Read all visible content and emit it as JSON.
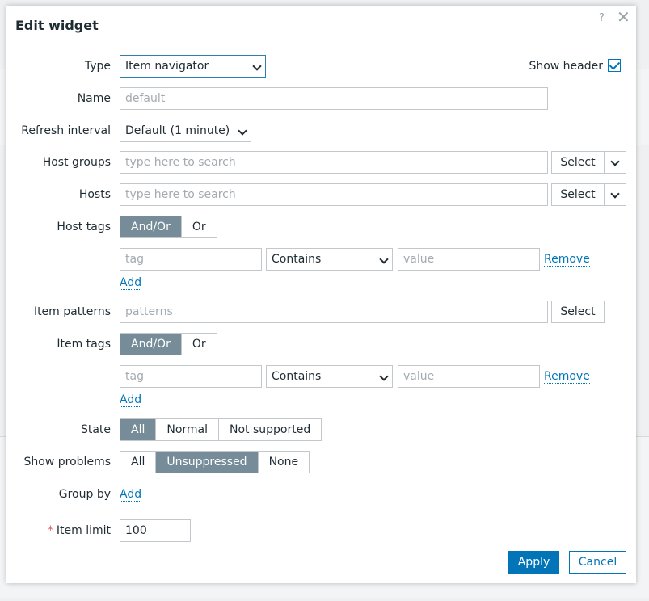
{
  "dialog": {
    "title": "Edit widget",
    "help": "?",
    "close": "✕"
  },
  "form": {
    "type": {
      "label": "Type",
      "value": "Item navigator"
    },
    "show_header": {
      "label": "Show header",
      "checked": true
    },
    "name": {
      "label": "Name",
      "placeholder": "default",
      "value": ""
    },
    "refresh": {
      "label": "Refresh interval",
      "value": "Default (1 minute)"
    },
    "host_groups": {
      "label": "Host groups",
      "placeholder": "type here to search",
      "select": "Select"
    },
    "hosts": {
      "label": "Hosts",
      "placeholder": "type here to search",
      "select": "Select"
    },
    "host_tags": {
      "label": "Host tags",
      "modes": [
        "And/Or",
        "Or"
      ],
      "active_mode": "And/Or",
      "tag_placeholder": "tag",
      "operator": "Contains",
      "value_placeholder": "value",
      "remove": "Remove",
      "add": "Add"
    },
    "item_patterns": {
      "label": "Item patterns",
      "placeholder": "patterns",
      "select": "Select"
    },
    "item_tags": {
      "label": "Item tags",
      "modes": [
        "And/Or",
        "Or"
      ],
      "active_mode": "And/Or",
      "tag_placeholder": "tag",
      "operator": "Contains",
      "value_placeholder": "value",
      "remove": "Remove",
      "add": "Add"
    },
    "state": {
      "label": "State",
      "options": [
        "All",
        "Normal",
        "Not supported"
      ],
      "active": "All"
    },
    "show_problems": {
      "label": "Show problems",
      "options": [
        "All",
        "Unsuppressed",
        "None"
      ],
      "active": "Unsuppressed"
    },
    "group_by": {
      "label": "Group by",
      "add": "Add"
    },
    "item_limit": {
      "label": "Item limit",
      "required_mark": "*",
      "value": "100"
    }
  },
  "footer": {
    "apply": "Apply",
    "cancel": "Cancel"
  },
  "colors": {
    "accent": "#0275b8",
    "segment_active": "#768d99",
    "required": "#e45959"
  }
}
